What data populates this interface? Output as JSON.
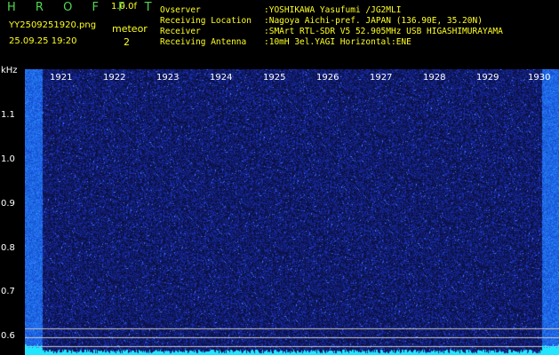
{
  "header": {
    "app_title": "H R O F F T",
    "version": "1.0.0f",
    "file_name": "YY2509251920.png",
    "timestamp": "25.09.25 19:20",
    "meteor_label": "meteor",
    "meteor_count": "2"
  },
  "info": {
    "observer_label": "Ovserver",
    "observer_value": ":YOSHIKAWA Yasufumi /JG2MLI",
    "location_label": "Receiving Location",
    "location_value": ":Nagoya Aichi-pref. JAPAN (136.90E, 35.20N)",
    "receiver_label": "Receiver",
    "receiver_value": ":SMArt RTL-SDR V5 52.905MHz USB HIGASHIMURAYAMA",
    "antenna_label": "Receiving Antenna",
    "antenna_value": ":10mH 3el.YAGI Horizontal:ENE"
  },
  "spectrogram": {
    "y_unit": "kHz",
    "y_ticks": [
      "1.1",
      "1.0",
      "0.9",
      "0.8",
      "0.7",
      "0.6"
    ],
    "x_ticks": [
      "1921",
      "1922",
      "1923",
      "1924",
      "1925",
      "1926",
      "1927",
      "1928",
      "1929",
      "1930"
    ],
    "colors": {
      "background": "#000033",
      "noise": "#1a2ad0",
      "strong": "#5fb0ff",
      "baseline": "#22e6ff",
      "marker_line": "#c8c8c8"
    }
  }
}
